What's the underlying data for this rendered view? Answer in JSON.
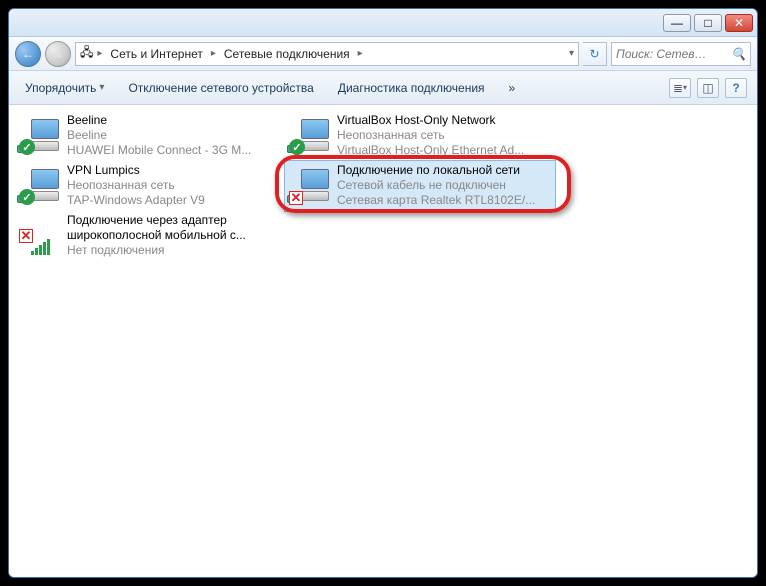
{
  "window": {
    "min": "—",
    "max": "□",
    "close": "✕"
  },
  "nav": {
    "back": "←",
    "fwd": "→"
  },
  "breadcrumb": {
    "root_icon": "🖧",
    "b1": "Сеть и Интернет",
    "b2": "Сетевые подключения"
  },
  "search": {
    "placeholder": "Поиск: Сетев…",
    "icon": "🔍"
  },
  "toolbar": {
    "organize": "Упорядочить",
    "disable": "Отключение сетевого устройства",
    "diag": "Диагностика подключения",
    "more": "»",
    "dd": "▾"
  },
  "items": [
    {
      "title": "Beeline",
      "sub1": "Beeline",
      "sub2": "HUAWEI Mobile Connect - 3G M...",
      "badge": "ok"
    },
    {
      "title": "VPN Lumpics",
      "sub1": "Неопознанная сеть",
      "sub2": "TAP-Windows Adapter V9",
      "badge": "ok"
    },
    {
      "title": "Подключение через адаптер широкополосной мобильной с...",
      "sub1": "",
      "sub2": "Нет подключения",
      "badge": "bars-x"
    },
    {
      "title": "VirtualBox Host-Only Network",
      "sub1": "Неопознанная сеть",
      "sub2": "VirtualBox Host-Only Ethernet Ad...",
      "badge": "ok"
    },
    {
      "title": "Подключение по локальной сети",
      "sub1": "Сетевой кабель не подключен",
      "sub2": "Сетевая карта Realtek RTL8102E/...",
      "badge": "x",
      "selected": true
    }
  ]
}
